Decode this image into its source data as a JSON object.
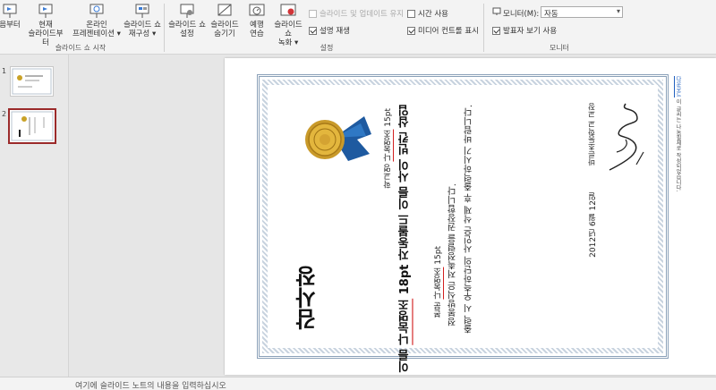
{
  "ribbon": {
    "btn_from_start": "음부터",
    "btn_from_current": [
      "현재",
      "슬라이드부터"
    ],
    "btn_online": [
      "온라인",
      "프레젠테이션 ▾"
    ],
    "btn_custom": [
      "슬라이드 쇼",
      "재구성 ▾"
    ],
    "group_start": "슬라이드 쇼 시작",
    "btn_setup": [
      "슬라이드 쇼",
      "설정"
    ],
    "btn_hide": [
      "슬라이드",
      "숨기기"
    ],
    "btn_rehearse": [
      "예행",
      "연습"
    ],
    "btn_record": [
      "슬라이드 쇼",
      "녹화 ▾"
    ],
    "chk_keep_updated": "슬라이드 및 업데이트 유지",
    "chk_play_narration": "설명 재생",
    "chk_use_timings": "시간 사용",
    "chk_media_controls": "미디어 컨트롤 표시",
    "group_setup": "설정",
    "monitor_label": "모니터(M):",
    "monitor_value": "자동",
    "chk_presenter_view": "발표자 보기 사용",
    "group_monitor": "모니터"
  },
  "thumbnails": [
    {
      "number": "1",
      "selected": false
    },
    {
      "number": "2",
      "selected": true
    }
  ],
  "slide": {
    "title": "감사장",
    "school_label_prefix": "학교명",
    "school_label_font": "나눔명조",
    "school_label_size": "15pt",
    "name_line_prefix": "이름",
    "name_line_font": "나눔명조",
    "name_line_rest": "18pt 자동볼드 이름 사이 빈칸 삽입",
    "body_label_prefix": "본문",
    "body_label_font": "나눔명조",
    "body_label_size": "15pt",
    "body_line1": "정봉방식은 저촉정렬을 권장합니다.",
    "body_line2": "출력 시 우측하단의 사인은 삭제 후 출력하시기 바랍니다.",
    "date": "2012년 6월 12일",
    "school_sign": "바른초등학교 교장",
    "side_note_prefix": "이 글씨는 나눔필체로 작성되었습니다.",
    "side_note_link": "다운로드"
  },
  "notes": {
    "placeholder": "여기에 슬라이드 노트의 내용을 입력하십시오"
  }
}
